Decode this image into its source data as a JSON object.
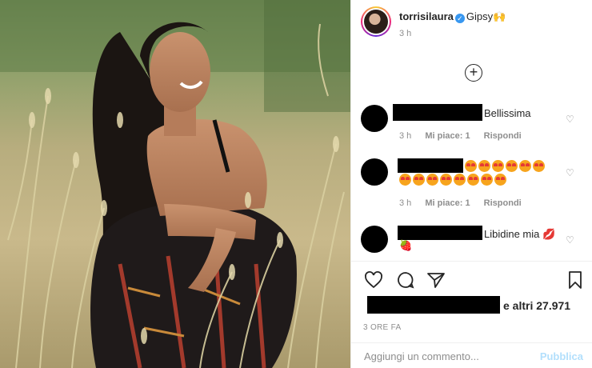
{
  "post": {
    "username": "torrisilaura",
    "caption": "Gipsy",
    "caption_emoji": "🙌",
    "time": "3 h"
  },
  "comments": [
    {
      "text": "Bellissima",
      "time": "3 h",
      "likes": "Mi piace: 1",
      "reply": "Rispondi"
    },
    {
      "text": "",
      "emoji_count_row1": 6,
      "emoji_count_row2": 8,
      "time": "3 h",
      "likes": "Mi piace: 1",
      "reply": "Rispondi"
    },
    {
      "text": "Libidine mia",
      "text_emoji": "💋",
      "extra_emoji": "🍓"
    }
  ],
  "likes_text": "e altri 27.971",
  "post_time": "3 ORE FA",
  "comment_box": {
    "placeholder": "Aggiungi un commento...",
    "publish_label": "Pubblica"
  },
  "colors": {
    "accent_blue": "#3897f0",
    "publish_disabled": "#b2dffc",
    "muted": "#8e8e8e"
  }
}
